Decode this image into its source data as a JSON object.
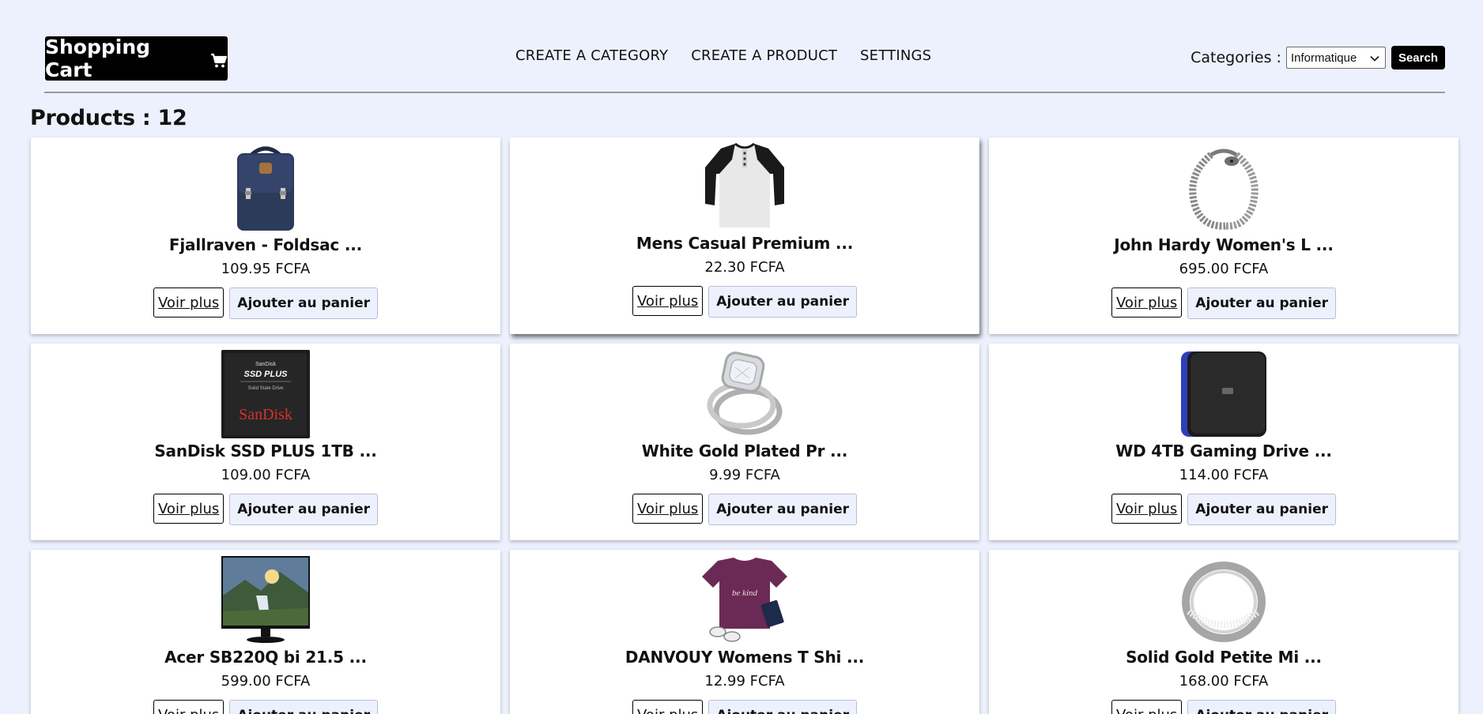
{
  "brand": {
    "label": "Shopping Cart",
    "icon": "cart-icon"
  },
  "nav": [
    {
      "label": "CREATE A CATEGORY"
    },
    {
      "label": "CREATE A PRODUCT"
    },
    {
      "label": "SETTINGS"
    }
  ],
  "filter": {
    "label": "Categories :",
    "selected": "Informatique",
    "search_label": "Search"
  },
  "products_title": "Products : 12",
  "products": [
    {
      "name": "Fjallraven - Foldsac ...",
      "price": "109.95 FCFA",
      "image": "backpack-image"
    },
    {
      "name": "Mens Casual Premium ...",
      "price": "22.30 FCFA",
      "image": "tshirt-image"
    },
    {
      "name": "John Hardy Women's L ...",
      "price": "695.00 FCFA",
      "image": "bracelet-image"
    },
    {
      "name": "SanDisk SSD PLUS 1TB ...",
      "price": "109.00 FCFA",
      "image": "ssd-image"
    },
    {
      "name": "White Gold Plated Pr ...",
      "price": "9.99 FCFA",
      "image": "ring-image"
    },
    {
      "name": "WD 4TB Gaming Drive ...",
      "price": "114.00 FCFA",
      "image": "hard-drive-image"
    },
    {
      "name": "Acer SB220Q bi 21.5 ...",
      "price": "599.00 FCFA",
      "image": "monitor-image"
    },
    {
      "name": "DANVOUY Womens T Shi ...",
      "price": "12.99 FCFA",
      "image": "womens-tshirt-image"
    },
    {
      "name": "Solid Gold Petite Mi ...",
      "price": "168.00 FCFA",
      "image": "gold-ring-image"
    }
  ],
  "buttons": {
    "more": "Voir plus",
    "add": "Ajouter au panier"
  },
  "ssd_text": {
    "top": "SanDisk",
    "model": "SSD PLUS",
    "sub": "Solid State Drive",
    "brand": "SanDisk"
  },
  "shirt_text": "be kind",
  "colors": {
    "background": "#edf1fd",
    "brand_bg": "#000000",
    "card_bg": "#ffffff"
  }
}
